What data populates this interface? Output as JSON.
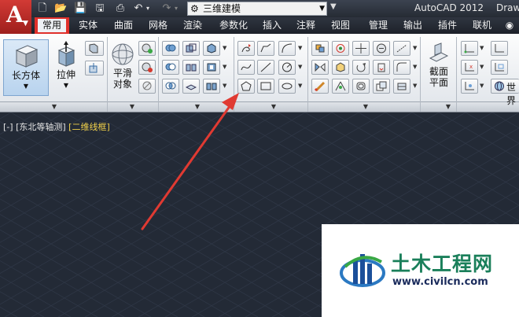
{
  "titlebar": {
    "app_title": "AutoCAD 2012",
    "doc_title": "Draw",
    "workspace": "三维建模",
    "quick_access_icons": [
      "new-icon",
      "open-icon",
      "save-icon",
      "save-as-icon",
      "print-icon",
      "undo-icon",
      "redo-icon"
    ]
  },
  "tabs": [
    {
      "label": "常用",
      "active": true
    },
    {
      "label": "实体"
    },
    {
      "label": "曲面"
    },
    {
      "label": "网格"
    },
    {
      "label": "渲染"
    },
    {
      "label": "参数化"
    },
    {
      "label": "插入"
    },
    {
      "label": "注释"
    },
    {
      "label": "视图"
    },
    {
      "label": "管理"
    },
    {
      "label": "输出"
    },
    {
      "label": "插件"
    },
    {
      "label": "联机"
    }
  ],
  "ribbon": {
    "box_label": "长方体",
    "extrude_label": "拉伸",
    "smooth_label_1": "平滑",
    "smooth_label_2": "对象",
    "section_label_1": "截面",
    "section_label_2": "平面",
    "world_label": "世界"
  },
  "viewport": {
    "view_control": "[-]",
    "view_name": "[东北等轴测]",
    "visual_style": "[二维线框]"
  },
  "watermark": {
    "title": "土木工程网",
    "url": "www.civilcn.com"
  },
  "colors": {
    "viewport_bg": "#232a36",
    "grid": "#2f3746",
    "highlight": "#e0302b",
    "visual_style_text": "#f0d04a"
  }
}
